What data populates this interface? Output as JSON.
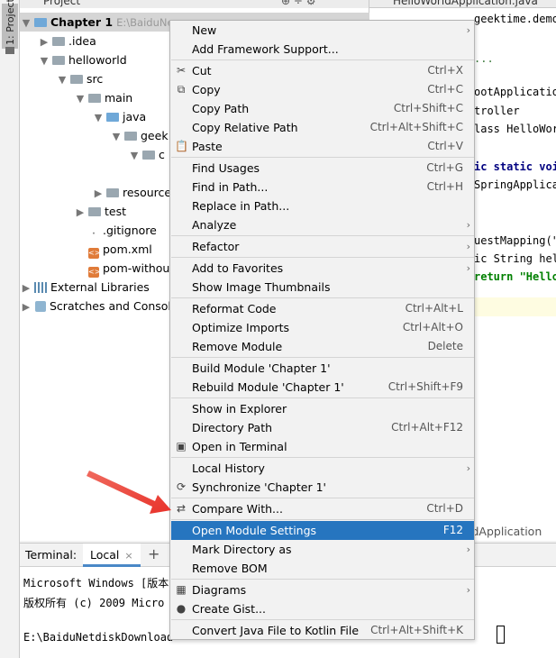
{
  "left_strip": {
    "tab_label": "1: Project"
  },
  "project_panel": {
    "header_title": "Project",
    "root_label": "Chapter 1",
    "root_path": "E:\\BaiduNe",
    "tree": [
      {
        "label": "Chapter 1",
        "arrow": "▼",
        "indent": 0,
        "icon": "folder-blue",
        "selected": true
      },
      {
        "label": ".idea",
        "arrow": "▶",
        "indent": 1,
        "icon": "folder"
      },
      {
        "label": "helloworld",
        "arrow": "▼",
        "indent": 1,
        "icon": "folder"
      },
      {
        "label": "src",
        "arrow": "▼",
        "indent": 2,
        "icon": "folder"
      },
      {
        "label": "main",
        "arrow": "▼",
        "indent": 3,
        "icon": "folder"
      },
      {
        "label": "java",
        "arrow": "▼",
        "indent": 4,
        "icon": "folder-blue"
      },
      {
        "label": "geek",
        "arrow": "▼",
        "indent": 5,
        "icon": "folder"
      },
      {
        "label": "c",
        "arrow": "▼",
        "indent": 6,
        "icon": "folder"
      },
      {
        "label": "resource",
        "arrow": "▶",
        "indent": 4,
        "icon": "folder"
      },
      {
        "label": "test",
        "arrow": "▶",
        "indent": 3,
        "icon": "folder"
      },
      {
        "label": ".gitignore",
        "arrow": "",
        "indent": 3,
        "icon": "git"
      },
      {
        "label": "pom.xml",
        "arrow": "",
        "indent": 3,
        "icon": "xml"
      },
      {
        "label": "pom-without-p",
        "arrow": "",
        "indent": 3,
        "icon": "xml"
      },
      {
        "label": "External Libraries",
        "arrow": "▶",
        "indent": 0,
        "icon": "library"
      },
      {
        "label": "Scratches and Consol",
        "arrow": "▶",
        "indent": 0,
        "icon": "scratch"
      }
    ]
  },
  "editor": {
    "tab_name": "HelloWorldApplication.java",
    "lines": [
      {
        "text": "geektime.demo"
      },
      {
        "text": "..."
      },
      {
        "text": "ootApplication"
      },
      {
        "text": "troller"
      },
      {
        "text": "lass HelloWor"
      },
      {
        "text": "ic static voi"
      },
      {
        "text": "SpringApplica"
      },
      {
        "text": "uestMapping(\""
      },
      {
        "text": "ic String hel"
      },
      {
        "text": "return \"Hello"
      }
    ],
    "breadcrumb": "ldApplication"
  },
  "terminal": {
    "label": "Terminal:",
    "tab": "Local",
    "tab_close": "×",
    "add": "+",
    "lines": [
      "Microsoft Windows [版本",
      "版权所有 (c) 2009 Micro",
      "",
      "E:\\BaiduNetdiskDownload"
    ]
  },
  "context_menu": {
    "items": [
      {
        "label": "New",
        "shortcut": "",
        "submenu": true,
        "icon": ""
      },
      {
        "label": "Add Framework Support...",
        "shortcut": "",
        "submenu": false,
        "icon": ""
      },
      {
        "label": "Cut",
        "shortcut": "Ctrl+X",
        "submenu": false,
        "icon": "✂"
      },
      {
        "label": "Copy",
        "shortcut": "Ctrl+C",
        "submenu": false,
        "icon": "⧉"
      },
      {
        "label": "Copy Path",
        "shortcut": "Ctrl+Shift+C",
        "submenu": false,
        "icon": ""
      },
      {
        "label": "Copy Relative Path",
        "shortcut": "Ctrl+Alt+Shift+C",
        "submenu": false,
        "icon": ""
      },
      {
        "label": "Paste",
        "shortcut": "Ctrl+V",
        "submenu": false,
        "icon": "📋"
      },
      {
        "label": "Find Usages",
        "shortcut": "Ctrl+G",
        "submenu": false,
        "icon": ""
      },
      {
        "label": "Find in Path...",
        "shortcut": "Ctrl+H",
        "submenu": false,
        "icon": ""
      },
      {
        "label": "Replace in Path...",
        "shortcut": "",
        "submenu": false,
        "icon": ""
      },
      {
        "label": "Analyze",
        "shortcut": "",
        "submenu": true,
        "icon": ""
      },
      {
        "label": "Refactor",
        "shortcut": "",
        "submenu": true,
        "icon": ""
      },
      {
        "label": "Add to Favorites",
        "shortcut": "",
        "submenu": true,
        "icon": ""
      },
      {
        "label": "Show Image Thumbnails",
        "shortcut": "",
        "submenu": false,
        "icon": ""
      },
      {
        "label": "Reformat Code",
        "shortcut": "Ctrl+Alt+L",
        "submenu": false,
        "icon": ""
      },
      {
        "label": "Optimize Imports",
        "shortcut": "Ctrl+Alt+O",
        "submenu": false,
        "icon": ""
      },
      {
        "label": "Remove Module",
        "shortcut": "Delete",
        "submenu": false,
        "icon": ""
      },
      {
        "label": "Build Module 'Chapter 1'",
        "shortcut": "",
        "submenu": false,
        "icon": ""
      },
      {
        "label": "Rebuild Module 'Chapter 1'",
        "shortcut": "Ctrl+Shift+F9",
        "submenu": false,
        "icon": ""
      },
      {
        "label": "Show in Explorer",
        "shortcut": "",
        "submenu": false,
        "icon": ""
      },
      {
        "label": "Directory Path",
        "shortcut": "Ctrl+Alt+F12",
        "submenu": false,
        "icon": ""
      },
      {
        "label": "Open in Terminal",
        "shortcut": "",
        "submenu": false,
        "icon": "▣"
      },
      {
        "label": "Local History",
        "shortcut": "",
        "submenu": true,
        "icon": ""
      },
      {
        "label": "Synchronize 'Chapter 1'",
        "shortcut": "",
        "submenu": false,
        "icon": "⟳"
      },
      {
        "label": "Compare With...",
        "shortcut": "Ctrl+D",
        "submenu": false,
        "icon": "⇄"
      },
      {
        "label": "Open Module Settings",
        "shortcut": "F12",
        "submenu": false,
        "icon": "",
        "active": true
      },
      {
        "label": "Mark Directory as",
        "shortcut": "",
        "submenu": true,
        "icon": ""
      },
      {
        "label": "Remove BOM",
        "shortcut": "",
        "submenu": false,
        "icon": ""
      },
      {
        "label": "Diagrams",
        "shortcut": "",
        "submenu": true,
        "icon": "▦"
      },
      {
        "label": "Create Gist...",
        "shortcut": "",
        "submenu": false,
        "icon": "●"
      },
      {
        "label": "Convert Java File to Kotlin File",
        "shortcut": "Ctrl+Alt+Shift+K",
        "submenu": false,
        "icon": ""
      }
    ]
  },
  "colors": {
    "menu_highlight": "#2675bf",
    "annotation_arrow": "#e8322a"
  }
}
